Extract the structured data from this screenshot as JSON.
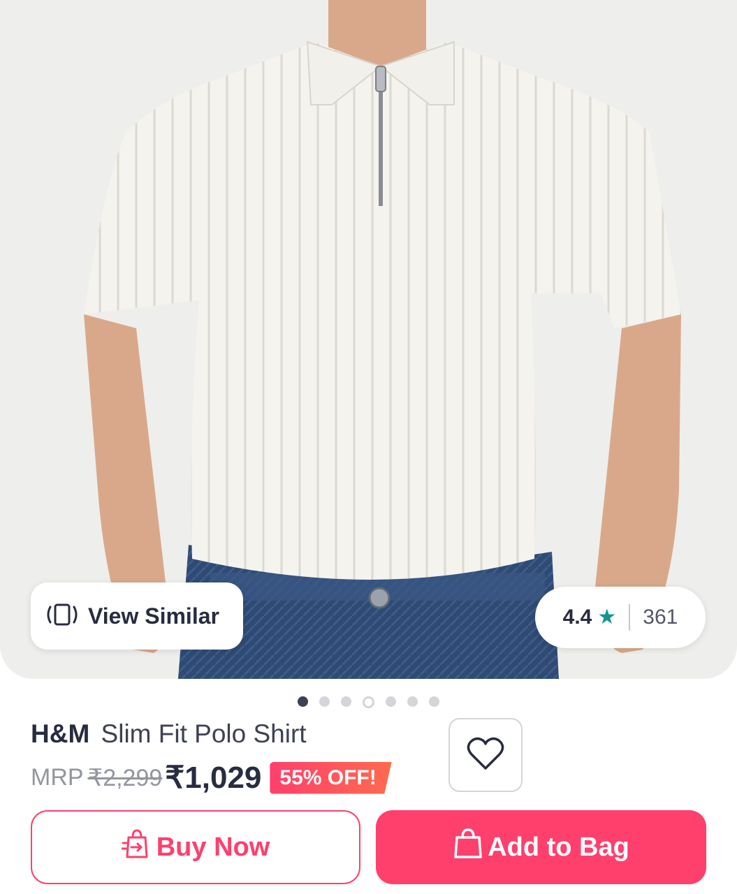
{
  "product": {
    "image_alt": "white ribbed knit zip polo shirt",
    "images_count": 7,
    "active_image_index": 0,
    "brand": "H&M",
    "name": "Slim Fit Polo Shirt",
    "mrp_label": "MRP",
    "mrp": "₹2,299",
    "price": "₹1,029",
    "discount": "55% OFF!"
  },
  "overlay": {
    "view_similar_label": "View Similar",
    "rating_value": "4.4",
    "rating_count": "361"
  },
  "actions": {
    "buy_now_label": "Buy Now",
    "add_to_bag_label": "Add to Bag",
    "wishlist_icon": "heart-icon"
  },
  "colors": {
    "accent": "#ff3f6c",
    "rating_star": "#14958f",
    "text_primary": "#282c3f",
    "text_muted": "#94969f",
    "hero_bg": "#eeeeec"
  }
}
